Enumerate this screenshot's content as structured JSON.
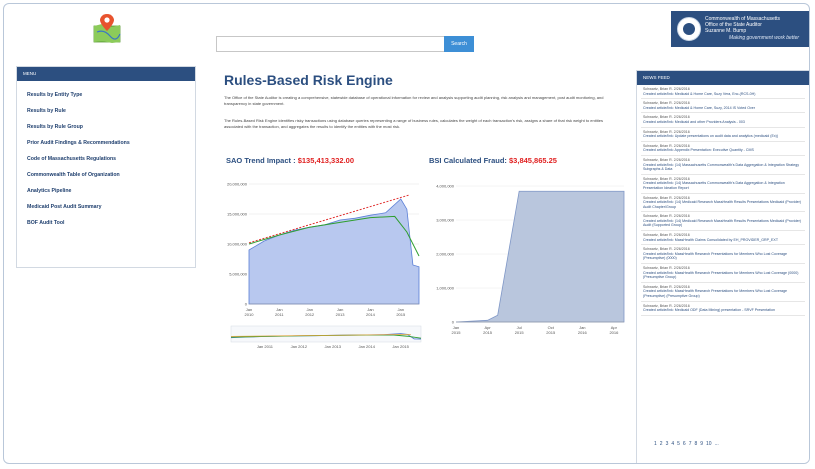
{
  "header": {
    "search_button": "Search",
    "brand_lines": [
      "Commonwealth of Massachusetts",
      "Office of the State Auditor",
      "Suzanne M. Bump"
    ],
    "brand_tagline": "Making government work better"
  },
  "menu": {
    "heading": "MENU",
    "items": [
      "Results by Entity Type",
      "Results by Rule",
      "Results by Rule Group",
      "Prior Audit Findings & Recommendations",
      "Code of Massachusetts Regulations",
      "Commonwealth Table of Organization",
      "Analytics Pipeline",
      "Medicaid Post Audit Summary",
      "BOF Audit Tool"
    ]
  },
  "main": {
    "title": "Rules-Based Risk Engine",
    "paragraph1": "The Office of the State Auditor is creating a comprehensive, statewide database of operational information for review and analysis supporting audit planning, risk analysis and management, post audit monitoring, and transparency in state government.",
    "paragraph2": "The Rules-Based Risk Engine identifies risky transactions using database queries representing a range of business rules, calculates the weight of each transaction's risk, assigns a share of that risk weight to entities associated with the transaction, and aggregates the results to identify the entities with the most risk."
  },
  "chart_data": [
    {
      "type": "area",
      "title": "SAO Trend Impact : ",
      "title_amount": "$135,413,332.00",
      "y_ticks": [
        "20,000,000",
        "15,000,000",
        "10,000,000",
        "5,000,000",
        "0"
      ],
      "x_ticks": [
        "Jan 2010",
        "Jan 2011",
        "Jan 2012",
        "Jan 2013",
        "Jan 2014",
        "Jan 2015"
      ],
      "ylim": [
        0,
        20000000
      ],
      "series": [
        {
          "name": "",
          "color": "#5b7fd6",
          "x": [
            2010,
            2010.5,
            2011,
            2011.5,
            2012,
            2012.5,
            2013,
            2013.5,
            2014,
            2014.5,
            2015,
            2015.2,
            2015.4,
            2015.6
          ],
          "values": [
            9000000,
            10500000,
            11500000,
            12300000,
            12800000,
            13200000,
            14000000,
            14300000,
            14800000,
            15200000,
            17500000,
            15800000,
            6500000,
            6200000
          ]
        },
        {
          "name": "",
          "color": "#2e9e2e",
          "x": [
            2010,
            2011,
            2012,
            2013,
            2014,
            2014.8,
            2015.2,
            2015.6
          ],
          "values": [
            10000000,
            11500000,
            12800000,
            13600000,
            14400000,
            14600000,
            12000000,
            8000000
          ]
        },
        {
          "name": "",
          "color": "#e03030",
          "dashed": true,
          "x": [
            2010,
            2015.3
          ],
          "values": [
            10200000,
            18200000
          ]
        }
      ],
      "navigator_ticks": [
        "Jan 2011",
        "Jan 2012",
        "Jan 2013",
        "Jan 2014",
        "Jan 2015"
      ]
    },
    {
      "type": "area",
      "title": "BSI Calculated Fraud: ",
      "title_amount": "$3,845,865.25",
      "y_ticks": [
        "4,000,000",
        "3,000,000",
        "2,000,000",
        "1,000,000",
        "0"
      ],
      "x_ticks": [
        "Jan 2015",
        "Apr 2015",
        "Jul 2015",
        "Oct 2015",
        "Jan 2016",
        "Apr 2016"
      ],
      "ylim": [
        0,
        4000000
      ],
      "series": [
        {
          "name": "",
          "color": "#7f97c7",
          "x": [
            2015.0,
            2015.25,
            2015.33,
            2015.5,
            2016.33
          ],
          "values": [
            0,
            50000,
            200000,
            3845865,
            3845865
          ]
        }
      ]
    }
  ],
  "news": {
    "heading": "NEWS FEED",
    "items": [
      {
        "meta": "Schwartz, Brian R.  2/26/2016",
        "text": "Created article/link: Medicaid & Home Care, Suzy Vera, Enc-(RCS-0H)"
      },
      {
        "meta": "Schwartz, Brian R.  2/26/2016",
        "text": "Created article/link: Medicaid & Home Care, Suzy, 2014 IS Voted Over"
      },
      {
        "meta": "Schwartz, Brian R.  2/26/2016",
        "text": "Created article/link: Medicaid and other Providers Analysis - 003"
      },
      {
        "meta": "Schwartz, Brian R.  2/26/2016",
        "text": "Created article/link: Update presentations on audit data and analytics (medicaid (Ex))"
      },
      {
        "meta": "Schwartz, Brian R.  2/26/2016",
        "text": "Created article/link: Appendix Presentation: Executive Quantity - CMS"
      },
      {
        "meta": "Schwartz, Brian R.  2/26/2016",
        "text": "Created article/link: (14) Massachusetts Commonwealth's Data Aggregation & Integration Strategy Subgraphs & Data"
      },
      {
        "meta": "Schwartz, Brian R.  2/26/2016",
        "text": "Created article/link: (14) Massachusetts Commonwealth's Data Aggregation & Integration Presentation Ideation Report"
      },
      {
        "meta": "Schwartz, Brian R.  2/26/2016",
        "text": "Created article/link: (14) Medicaid Research MassHealth Results Presentations Medicaid (Provider) Audit Chapter/Group"
      },
      {
        "meta": "Schwartz, Brian R.  2/26/2016",
        "text": "Created article/link: (14) Medicaid Research MassHealth Results Presentations Medicaid (Provider) Audit (Supported Group)"
      },
      {
        "meta": "Schwartz, Brian R.  2/26/2016",
        "text": "Created article/link: MassHealth Claims Consolidated by EH_PROVIDER_GRP_EXT"
      },
      {
        "meta": "Schwartz, Brian R.  2/26/2016",
        "text": "Created article/link: MassHealth Research Presentations for Members Who Lost Coverage (Presumptive) (0000)"
      },
      {
        "meta": "Schwartz, Brian R.  2/26/2016",
        "text": "Created article/link: MassHealth Research Presentations for Members Who Lost Coverage (0000) (Presumptive Group)"
      },
      {
        "meta": "Schwartz, Brian R.  2/26/2016",
        "text": "Created article/link: MassHealth Research Presentations for Members Who Lost Coverage (Presumptive) (Presumptive Group)"
      },
      {
        "meta": "Schwartz, Brian R.  2/26/2016",
        "text": "Created article/link: Medicaid ODF (Data Mining) presentation - SRVF Presentation"
      }
    ],
    "pager": [
      "1",
      "2",
      "3",
      "4",
      "5",
      "6",
      "7",
      "8",
      "9",
      "10",
      "..."
    ]
  },
  "colors": {
    "brand": "#2c4f80",
    "accent": "#3d8fd6",
    "highlight": "#e02020"
  }
}
